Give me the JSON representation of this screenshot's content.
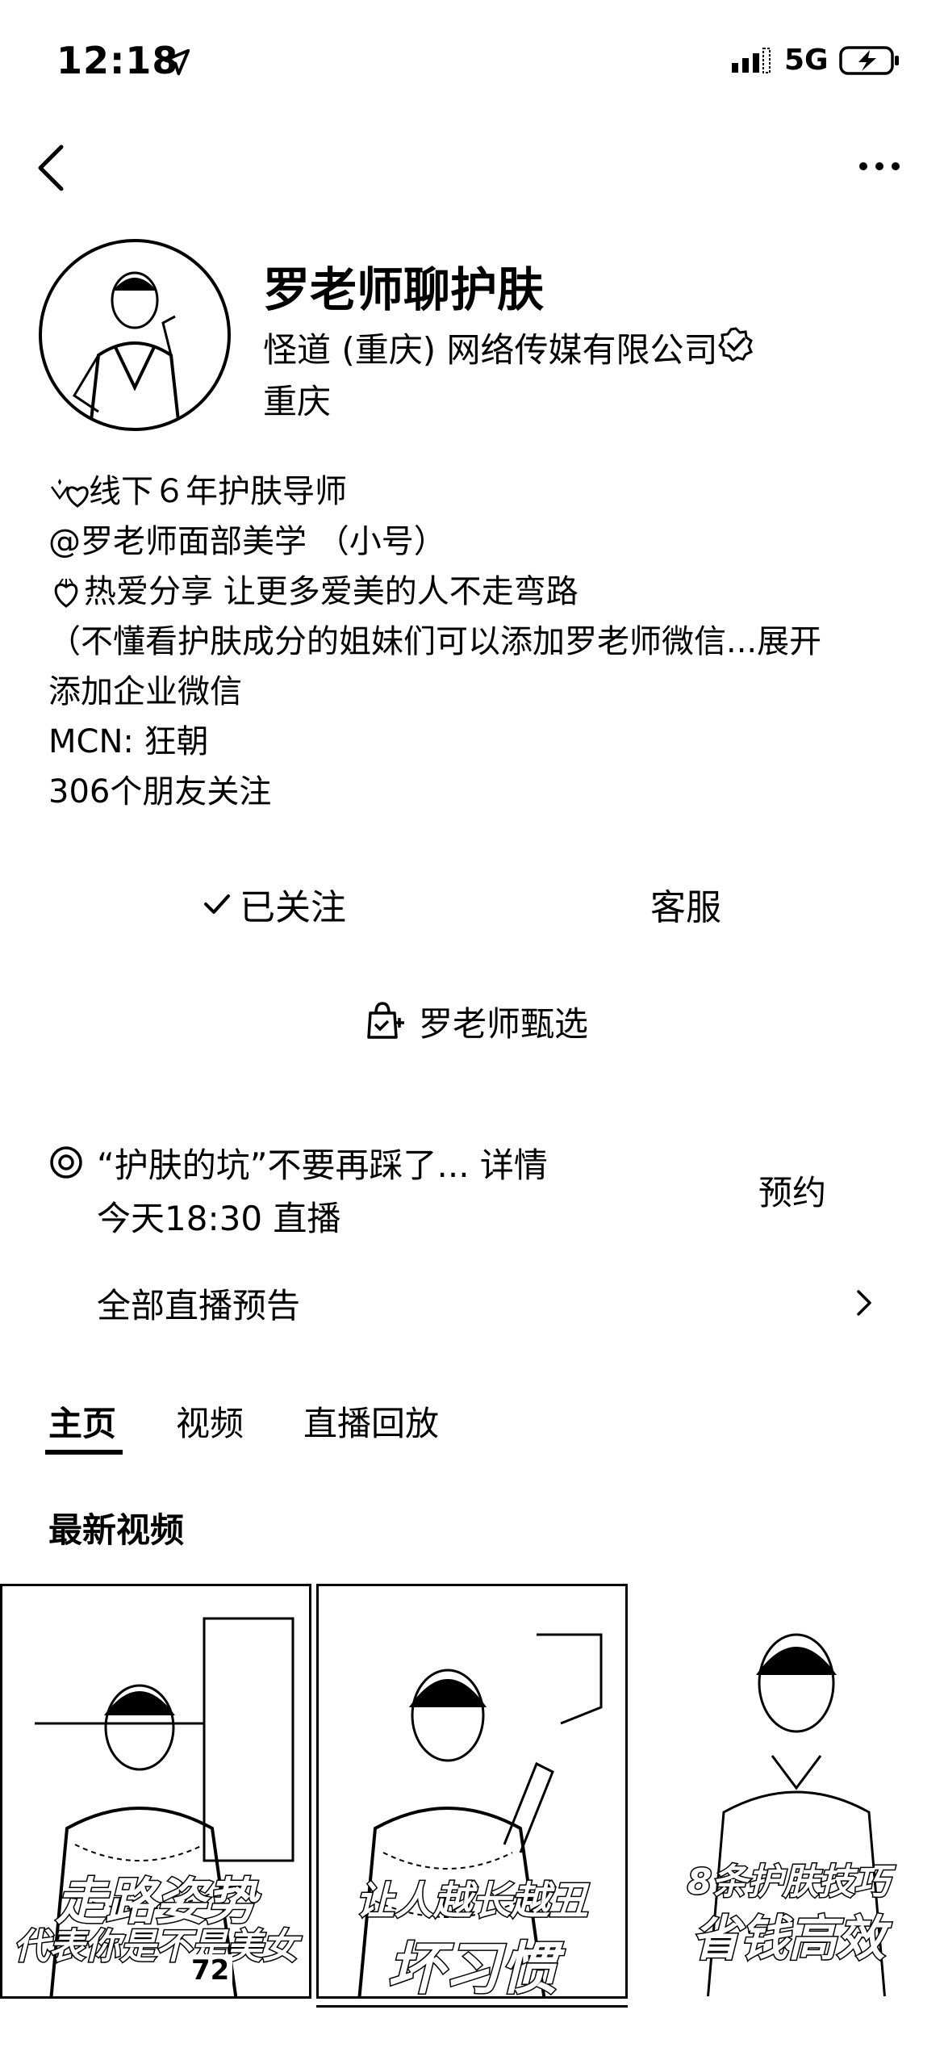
{
  "status_bar": {
    "time": "12:18",
    "network": "5G"
  },
  "profile": {
    "name": "罗老师聊护肤",
    "company": "怪道 (重庆) 网络传媒有限公司",
    "location": "重庆",
    "bio": {
      "line1": "线下６年护肤导师",
      "line2": "@罗老师面部美学 （小号）",
      "line3": "热爱分享 让更多爱美的人不走弯路",
      "line4_text": "（不懂看护肤成分的姐妹们可以添加罗老师微信...",
      "line4_expand": "展开",
      "line5": "添加企业微信",
      "line6": "MCN: 狂朝",
      "line7": "306个朋友关注"
    }
  },
  "actions": {
    "follow_label": "已关注",
    "service_label": "客服",
    "shop_label": "罗老师甄选"
  },
  "live": {
    "title": "“护肤的坑”不要再踩了... 详情",
    "time": "今天18:30 直播",
    "reserve_label": "预约",
    "all_label": "全部直播预告"
  },
  "tabs": [
    {
      "label": "主页",
      "active": true
    },
    {
      "label": "视频",
      "active": false
    },
    {
      "label": "直播回放",
      "active": false
    }
  ],
  "section_title": "最新视频",
  "videos": [
    {
      "caption_top": "走路姿势",
      "caption_bottom": "代表你是不是美女",
      "likes": "72"
    },
    {
      "caption_top": "让人越长越丑",
      "caption_bottom": "坏习惯",
      "likes": ""
    },
    {
      "caption_top": "8条护肤技巧",
      "caption_bottom": "省钱高效",
      "likes": ""
    }
  ]
}
